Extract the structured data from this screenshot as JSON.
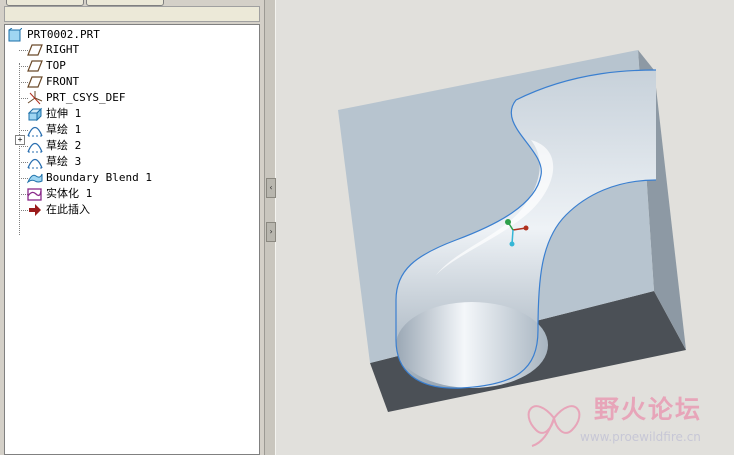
{
  "tree": {
    "root": "PRT0002.PRT",
    "items": [
      {
        "label": "RIGHT",
        "icon": "datum-plane-icon"
      },
      {
        "label": "TOP",
        "icon": "datum-plane-icon"
      },
      {
        "label": "FRONT",
        "icon": "datum-plane-icon"
      },
      {
        "label": "PRT_CSYS_DEF",
        "icon": "coordinate-system-icon"
      },
      {
        "label": "拉伸 1",
        "icon": "extrude-icon"
      },
      {
        "label": "草绘 1",
        "icon": "sketch-icon"
      },
      {
        "label": "草绘 2",
        "icon": "sketch-icon"
      },
      {
        "label": "草绘 3",
        "icon": "sketch-icon"
      },
      {
        "label": "Boundary Blend 1",
        "icon": "boundary-blend-icon"
      },
      {
        "label": "实体化 1",
        "icon": "solidify-icon"
      },
      {
        "label": "在此插入",
        "icon": "insert-here-arrow-icon"
      }
    ]
  },
  "watermark": {
    "title": "野火论坛",
    "url": "www.proewildfire.cn"
  },
  "colors": {
    "viewport_bg": "#e1e0dc",
    "model_face": "#b7c4cf",
    "model_shadow": "#4b5056",
    "edge": "#3a7fd0"
  }
}
